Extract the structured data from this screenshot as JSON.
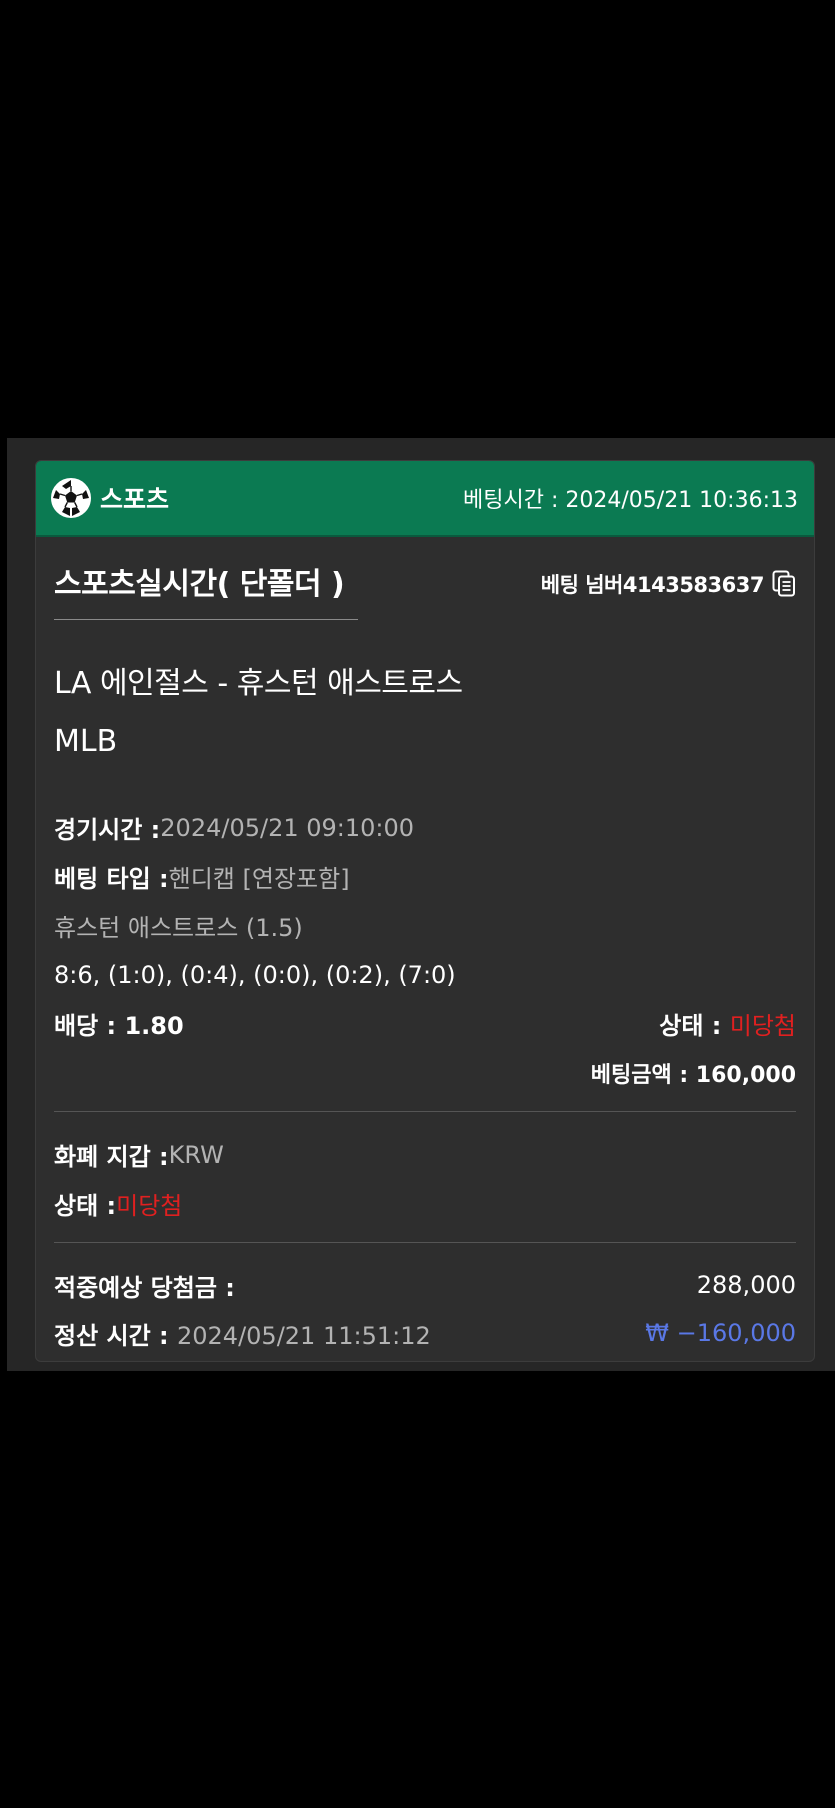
{
  "header": {
    "brand_label": "스포츠",
    "bet_time_label": "베팅시간 : 2024/05/21 10:36:13",
    "accent_color": "#0b7a52"
  },
  "market": {
    "title": "스포츠실시간( 단폴더 )",
    "bet_number": "베팅 넘버4143583637"
  },
  "match": {
    "teams": "LA 에인절스 - 휴스턴 애스트로스",
    "league": "MLB"
  },
  "details": {
    "game_time_label": "경기시간 : ",
    "game_time_value": "2024/05/21 09:10:00",
    "bet_type_label": "베팅 타입 : ",
    "bet_type_value": "핸디캡 [연장포함]",
    "selection": "휴스턴 애스트로스 (1.5)",
    "score": "8:6, (1:0), (0:4), (0:0), (0:2), (7:0)",
    "odds": "배당 : 1.80",
    "status_label": "상태 : ",
    "status_value": "미당첨",
    "bet_amount": "베팅금액 : 160,000"
  },
  "payment": {
    "currency_label": "화폐 지갑 : ",
    "currency_value": "KRW",
    "status_label": "상태 : ",
    "status_value": "미당첨"
  },
  "settlement": {
    "expected_label": "적중예상 당첨금 :",
    "expected_value": "288,000",
    "time_label": "정산 시간 : ",
    "time_value": "2024/05/21 11:51:12",
    "result_value": "₩ −160,000"
  },
  "icons": {
    "brand": "soccer-ball-icon",
    "copy": "copy-icon"
  }
}
